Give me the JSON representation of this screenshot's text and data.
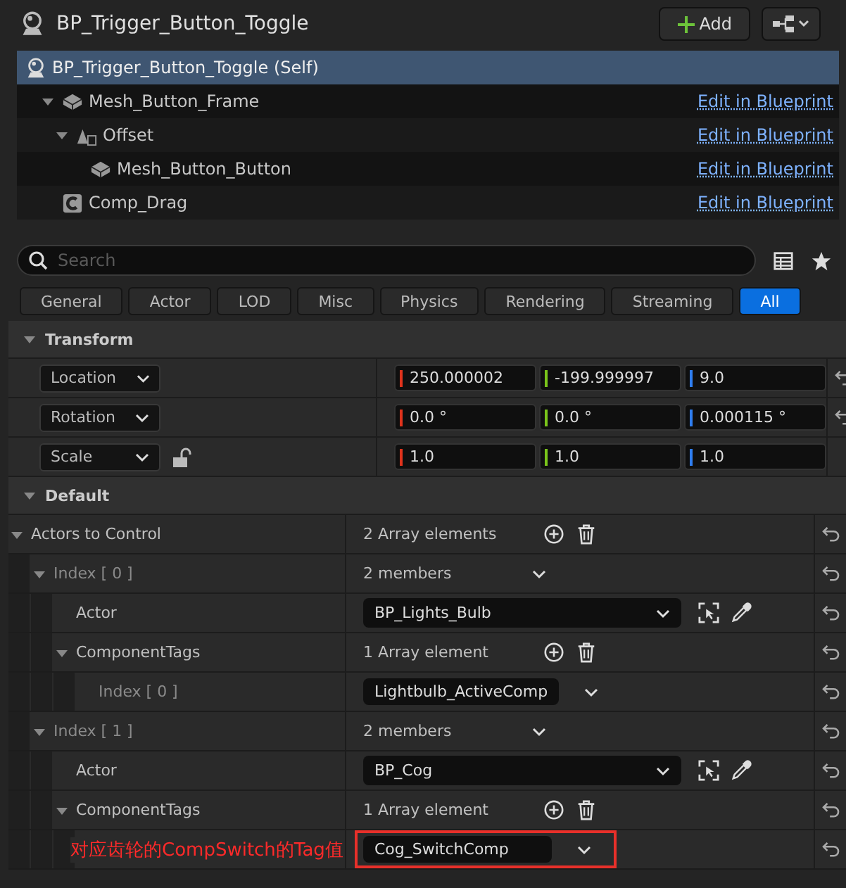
{
  "header": {
    "title": "BP_Trigger_Button_Toggle",
    "add_button": "Add"
  },
  "tree": [
    {
      "name": "BP_Trigger_Button_Toggle (Self)",
      "kind": "actor",
      "selected": true
    },
    {
      "name": "Mesh_Button_Frame",
      "kind": "mesh",
      "selected": false,
      "link": "Edit in Blueprint",
      "expanded": true,
      "children": [
        {
          "name": "Offset",
          "kind": "scene",
          "selected": false,
          "link": "Edit in Blueprint",
          "expanded": true,
          "children": [
            {
              "name": "Mesh_Button_Button",
              "kind": "mesh",
              "selected": false,
              "link": "Edit in Blueprint"
            }
          ]
        }
      ]
    },
    {
      "name": "Comp_Drag",
      "kind": "component",
      "selected": false,
      "link": "Edit in Blueprint"
    }
  ],
  "search": {
    "placeholder": "Search"
  },
  "filters": [
    {
      "label": "General",
      "selected": false
    },
    {
      "label": "Actor",
      "selected": false
    },
    {
      "label": "LOD",
      "selected": false
    },
    {
      "label": "Misc",
      "selected": false
    },
    {
      "label": "Physics",
      "selected": false
    },
    {
      "label": "Rendering",
      "selected": false
    },
    {
      "label": "Streaming",
      "selected": false
    },
    {
      "label": "All",
      "selected": true
    }
  ],
  "transform": {
    "title": "Transform",
    "expanded": true,
    "rows": [
      {
        "label": "Location",
        "values": [
          "250.000002",
          "-199.999997",
          "9.0"
        ],
        "resettable": true
      },
      {
        "label": "Rotation",
        "values": [
          "0.0 °",
          "0.0 °",
          "0.000115 °"
        ],
        "resettable": true
      },
      {
        "label": "Scale",
        "values": [
          "1.0",
          "1.0",
          "1.0"
        ],
        "locked": false,
        "resettable": false
      }
    ]
  },
  "default": {
    "title": "Default",
    "expanded": true,
    "properties": [
      {
        "label": "Actors to Control",
        "kind": "array",
        "value": "2 Array elements",
        "resettable": true,
        "expanded": true,
        "children": [
          {
            "label": "Index [ 0 ]",
            "kind": "struct",
            "value": "2 members",
            "resettable": true,
            "expanded": true,
            "children": [
              {
                "label": "Actor",
                "kind": "object",
                "value": "BP_Lights_Bulb",
                "resettable": true
              },
              {
                "label": "ComponentTags",
                "kind": "array",
                "value": "1 Array element",
                "resettable": true,
                "expanded": true,
                "children": [
                  {
                    "label": "Index [ 0 ]",
                    "kind": "combo",
                    "value": "Lightbulb_ActiveComp",
                    "resettable": true
                  }
                ]
              }
            ]
          },
          {
            "label": "Index [ 1 ]",
            "kind": "struct",
            "value": "2 members",
            "resettable": true,
            "expanded": true,
            "children": [
              {
                "label": "Actor",
                "kind": "object",
                "value": "BP_Cog",
                "resettable": true
              },
              {
                "label": "ComponentTags",
                "kind": "array",
                "value": "1 Array element",
                "resettable": true,
                "expanded": true,
                "children": [
                  {
                    "annotation": "对应齿轮的CompSwitch的Tag值",
                    "kind": "combo",
                    "value": "Cog_SwitchComp",
                    "resettable": true
                  }
                ]
              }
            ]
          }
        ]
      }
    ]
  }
}
